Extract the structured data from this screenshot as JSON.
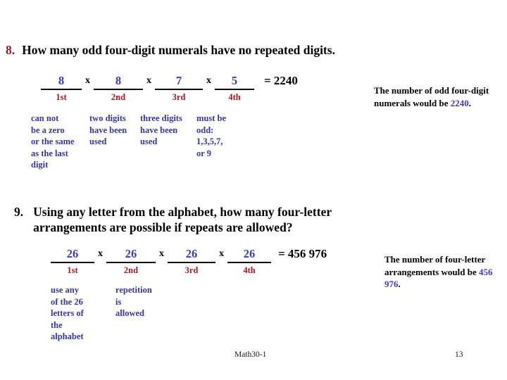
{
  "questions": [
    {
      "number": "8.",
      "number_color": "#9e1a24",
      "text": "How many odd four-digit numerals have no repeated digits.",
      "slots": [
        {
          "value": "8",
          "label": "1st"
        },
        {
          "value": "8",
          "label": "2nd"
        },
        {
          "value": "7",
          "label": "3rd"
        },
        {
          "value": "5",
          "label": "4th"
        }
      ],
      "operator": "x",
      "result": "= 2240",
      "reasons": [
        "can not\nbe a zero\nor the same\nas the last\ndigit",
        "two digits\nhave been\nused",
        "three digits\nhave been\nused",
        "must be\nodd:\n1,3,5,7,\nor 9"
      ],
      "note_lead": "The number of odd  four-digit numerals would be ",
      "note_value": "2240",
      "note_tail": "."
    },
    {
      "number": "9.",
      "number_color": "#000000",
      "text_line1": "Using any letter from the alphabet, how many four-letter",
      "text_line2": "arrangements are possible if repeats are allowed?",
      "slots": [
        {
          "value": "26",
          "label": "1st"
        },
        {
          "value": "26",
          "label": "2nd"
        },
        {
          "value": "26",
          "label": "3rd"
        },
        {
          "value": "26",
          "label": "4th"
        }
      ],
      "operator": "x",
      "result": "= 456 976",
      "reasons": [
        "use any\nof the 26\nletters of\nthe\nalphabet",
        "repetition\nis\nallowed"
      ],
      "note_lead": "The number of four-letter arrangements would be ",
      "note_value": "456 976",
      "note_tail": "."
    }
  ],
  "footer": {
    "course": "Math30-1",
    "page": "13"
  },
  "colors": {
    "value_blue": "#3b3bbb",
    "reason_blue": "#36369c",
    "label_red": "#9e1a24",
    "text_black": "#000000",
    "background": "#ffffff"
  }
}
